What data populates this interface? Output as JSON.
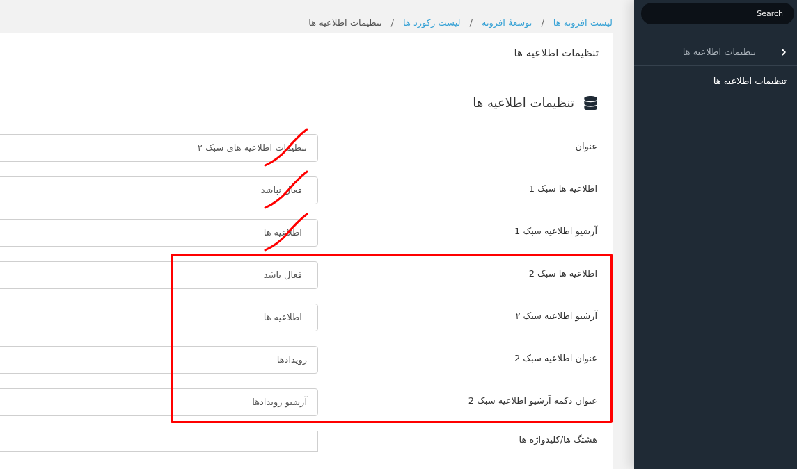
{
  "sidebar": {
    "search": {
      "placeholder": "Search"
    },
    "items": [
      {
        "label": "تنظیمات اطلاعیه ها",
        "kind": "group",
        "selected": false
      },
      {
        "label": "تنظیمات اطلاعیه ها",
        "kind": "link",
        "selected": true
      }
    ]
  },
  "breadcrumb": [
    {
      "kind": "link",
      "label": "لیست افزونه ها"
    },
    {
      "kind": "separator",
      "label": "/"
    },
    {
      "kind": "link",
      "label": "توسعهٔ افزونه"
    },
    {
      "kind": "separator",
      "label": "/"
    },
    {
      "kind": "link",
      "label": "لیست رکورد ها"
    },
    {
      "kind": "separator",
      "label": "/"
    },
    {
      "kind": "current",
      "label": "تنظیمات اطلاعیه ها"
    }
  ],
  "page_title": "تنظیمات اطلاعیه ها",
  "section": {
    "title": "تنظیمات اطلاعیه ها"
  },
  "fields": [
    {
      "label": "عنوان",
      "kind": "text",
      "value": "تنظیمات اطلاعیه های سبک ۲",
      "struck": true,
      "highlighted": false
    },
    {
      "label": "اطلاعیه ها سبک 1",
      "kind": "select",
      "value": "فعال نباشد",
      "struck": true,
      "highlighted": false
    },
    {
      "label": "آرشیو اطلاعیه سبک 1",
      "kind": "select",
      "value": "اطلاعیه ها",
      "struck": true,
      "highlighted": false
    },
    {
      "label": "اطلاعیه ها سبک 2",
      "kind": "select",
      "value": "فعال باشد",
      "struck": false,
      "highlighted": true
    },
    {
      "label": "آرشیو اطلاعیه سبک ۲",
      "kind": "select",
      "value": "اطلاعیه ها",
      "struck": false,
      "highlighted": true
    },
    {
      "label": "عنوان اطلاعیه سبک 2",
      "kind": "text",
      "value": "رویدادها",
      "struck": false,
      "highlighted": true
    },
    {
      "label": "عنوان دکمه آرشیو اطلاعیه سبک 2",
      "kind": "text",
      "value": "آرشیو رویدادها",
      "struck": false,
      "highlighted": true
    },
    {
      "label": "هشتگ ها/کلیدواژه ها",
      "kind": "tags",
      "struck": false,
      "highlighted": false
    }
  ]
}
